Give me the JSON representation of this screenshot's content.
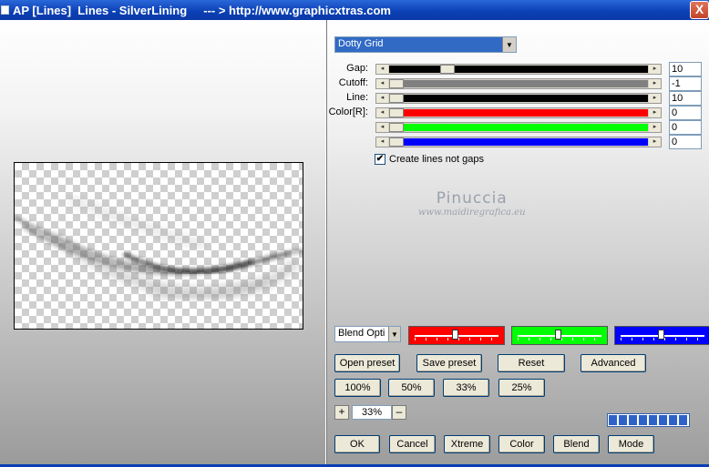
{
  "window": {
    "title": "AP [Lines]  Lines - SilverLining     --- > http://www.graphicxtras.com",
    "close_label": "X"
  },
  "preset": {
    "selected": "Dotty Grid"
  },
  "params": [
    {
      "label": "Gap:",
      "value": "10",
      "fill": "#000000"
    },
    {
      "label": "Cutoff:",
      "value": "-1",
      "fill": "#808080"
    },
    {
      "label": "Line:",
      "value": "10",
      "fill": "#000000"
    },
    {
      "label": "Color[R]:",
      "value": "0",
      "fill": "#ff0000"
    },
    {
      "label": "",
      "value": "0",
      "fill": "#00ff00"
    },
    {
      "label": "",
      "value": "0",
      "fill": "#0000ff"
    }
  ],
  "create_lines": {
    "label": "Create lines not gaps",
    "checked": true,
    "mark": "✔"
  },
  "watermark": {
    "line1": "Pinuccia",
    "line2": "www.maidiregrafica.eu"
  },
  "blend_options": {
    "selected": "Blend Opti"
  },
  "color_boxes": [
    {
      "color": "#ff0000"
    },
    {
      "color": "#00ff00"
    },
    {
      "color": "#0000ff"
    }
  ],
  "buttons": {
    "open_preset": "Open preset",
    "save_preset": "Save preset",
    "reset": "Reset",
    "advanced": "Advanced",
    "z100": "100%",
    "z50": "50%",
    "z33": "33%",
    "z25": "25%",
    "plus": "+",
    "minus": "–",
    "ok": "OK",
    "cancel": "Cancel",
    "xtreme": "Xtreme",
    "color": "Color",
    "blend": "Blend",
    "mode": "Mode"
  },
  "zoom": {
    "value": "33%"
  },
  "icons": {
    "left_arrow": "◂",
    "right_arrow": "▸",
    "dropdown": "▼"
  }
}
